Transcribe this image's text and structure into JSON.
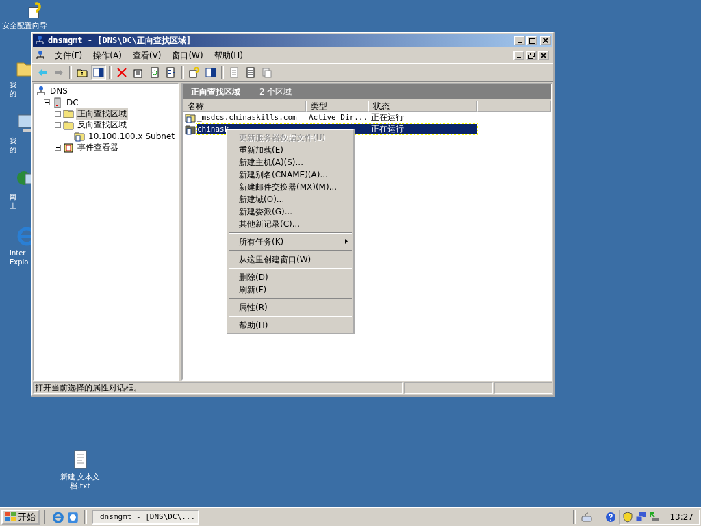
{
  "desktop_icons": [
    {
      "label": "安全配置向导",
      "kind": "wizard"
    },
    {
      "label": "我的",
      "kind": "folder"
    },
    {
      "label": "我的",
      "kind": "computer"
    },
    {
      "label": "网上",
      "kind": "network"
    },
    {
      "label": "Inter Explo",
      "kind": "browser"
    },
    {
      "label": "新建 文本文档.txt",
      "kind": "notepad"
    }
  ],
  "window": {
    "title": "dnsmgmt - [DNS\\DC\\正向查找区域]",
    "menu": [
      "文件(F)",
      "操作(A)",
      "查看(V)",
      "窗口(W)",
      "帮助(H)"
    ],
    "tree": [
      {
        "label": "DNS",
        "kind": "dns",
        "selected": false,
        "children": [
          {
            "label": "DC",
            "kind": "server",
            "selected": false,
            "expanded": true,
            "children": [
              {
                "label": "正向查找区域",
                "kind": "folder",
                "selected": true,
                "expanded": false
              },
              {
                "label": "反向查找区域",
                "kind": "folder",
                "selected": false,
                "expanded": true,
                "children": [
                  {
                    "label": "10.100.100.x Subnet",
                    "kind": "zone",
                    "selected": false
                  }
                ]
              },
              {
                "label": "事件查看器",
                "kind": "events",
                "selected": false,
                "expanded": false
              }
            ]
          }
        ]
      }
    ],
    "pane_title": "正向查找区域",
    "pane_count": "2 个区域",
    "table": {
      "columns": [
        "名称",
        "类型",
        "状态"
      ],
      "rows": [
        {
          "name": "_msdcs.chinaskills.com",
          "type": "Active Dir...",
          "status": "正在运行",
          "selected": false
        },
        {
          "name": "chinask",
          "status": "正在运行",
          "selected": true
        }
      ]
    },
    "status_bar": "打开当前选择的属性对话框。"
  },
  "context_menu": [
    {
      "kind": "item",
      "label": "更新服务器数据文件(U)",
      "disabled": true
    },
    {
      "kind": "item",
      "label": "重新加载(E)",
      "disabled": false
    },
    {
      "kind": "item",
      "label": "新建主机(A)(S)...",
      "disabled": false
    },
    {
      "kind": "item",
      "label": "新建别名(CNAME)(A)...",
      "disabled": false
    },
    {
      "kind": "item",
      "label": "新建邮件交换器(MX)(M)...",
      "disabled": false
    },
    {
      "kind": "item",
      "label": "新建域(O)...",
      "disabled": false
    },
    {
      "kind": "item",
      "label": "新建委派(G)...",
      "disabled": false
    },
    {
      "kind": "item",
      "label": "其他新记录(C)...",
      "disabled": false
    },
    {
      "kind": "separator"
    },
    {
      "kind": "submenu",
      "label": "所有任务(K)",
      "disabled": false
    },
    {
      "kind": "separator"
    },
    {
      "kind": "item",
      "label": "从这里创建窗口(W)",
      "disabled": false
    },
    {
      "kind": "separator"
    },
    {
      "kind": "item",
      "label": "删除(D)",
      "disabled": false
    },
    {
      "kind": "item",
      "label": "刷新(F)",
      "disabled": false
    },
    {
      "kind": "separator"
    },
    {
      "kind": "item",
      "label": "属性(R)",
      "disabled": false
    },
    {
      "kind": "separator"
    },
    {
      "kind": "item",
      "label": "帮助(H)",
      "disabled": false
    }
  ],
  "taskbar": {
    "start": "开始",
    "task": "dnsmgmt - [DNS\\DC\\...",
    "clock": "13:27"
  }
}
